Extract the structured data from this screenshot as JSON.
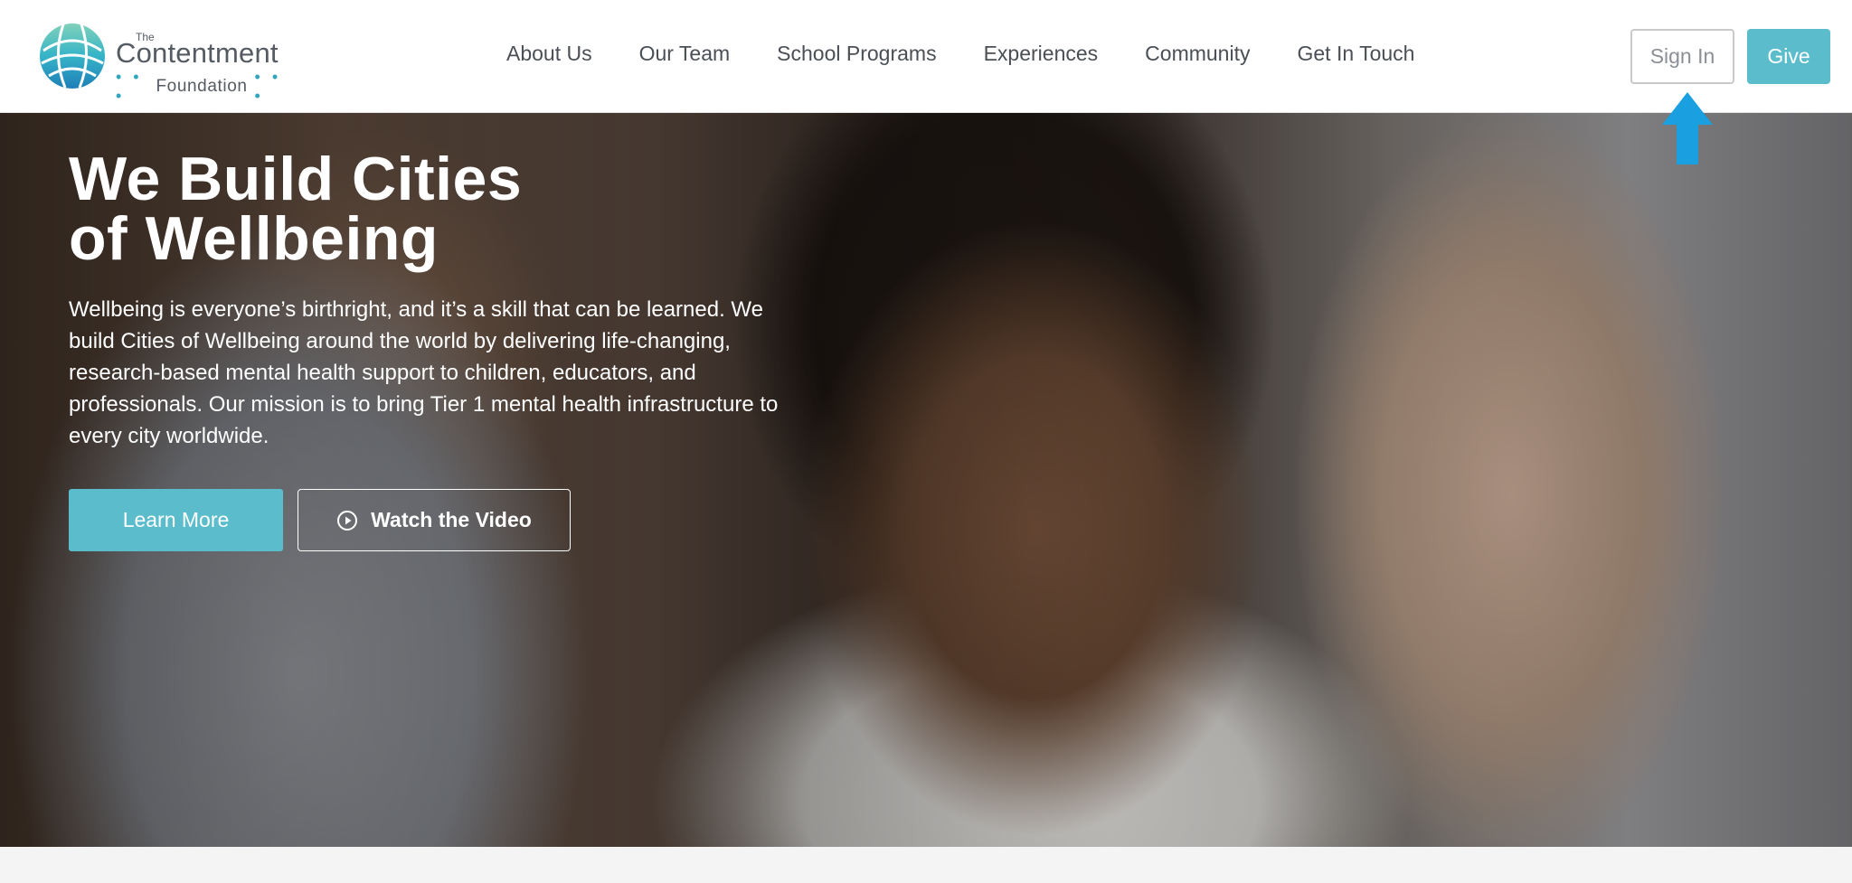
{
  "brand": {
    "logo_the": "The",
    "logo_main": "Contentment",
    "logo_sub": "Foundation",
    "logo_dots": "• • •",
    "colors": {
      "accent": "#5bbccc",
      "nav_text": "#4a4f56",
      "arrow": "#1a9fe0"
    }
  },
  "nav": {
    "items": [
      {
        "label": "About Us"
      },
      {
        "label": "Our Team"
      },
      {
        "label": "School Programs"
      },
      {
        "label": "Experiences"
      },
      {
        "label": "Community"
      },
      {
        "label": "Get In Touch"
      }
    ],
    "sign_in_label": "Sign In",
    "give_label": "Give"
  },
  "hero": {
    "title_line1": "We Build Cities",
    "title_line2": "of Wellbeing",
    "body": "Wellbeing is everyone’s birthright, and it’s a skill that can be learned. We build Cities of Wellbeing around the world by delivering life-changing, research-based mental health support to children, educators, and professionals. Our mission is to bring Tier 1 mental health infrastructure to every city worldwide.",
    "learn_more_label": "Learn More",
    "watch_video_label": "Watch the Video"
  },
  "icons": {
    "logo": "globe-logo-icon",
    "play": "play-circle-icon",
    "pointer": "up-arrow-icon"
  }
}
